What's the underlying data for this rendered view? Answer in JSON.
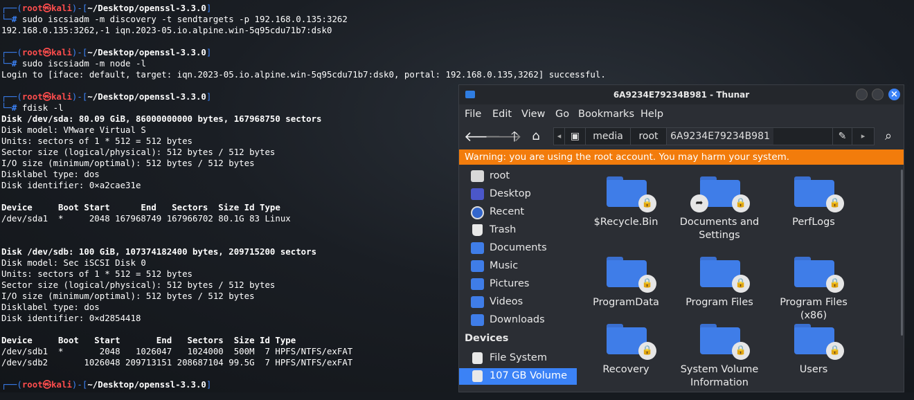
{
  "terminal": {
    "prompt_user": "root",
    "prompt_host": "kali",
    "prompt_path": "~/Desktop/openssl-3.3.0",
    "cmd1": "sudo iscsiadm -m discovery -t sendtargets -p 192.168.0.135:3262",
    "out1": "192.168.0.135:3262,-1 iqn.2023-05.io.alpine.win-5q95cdu71b7:dsk0",
    "cmd2": "sudo iscsiadm -m node -l",
    "out2": "Login to [iface: default, target: iqn.2023-05.io.alpine.win-5q95cdu71b7:dsk0, portal: 192.168.0.135,3262] successful.",
    "cmd3": "fdisk -l",
    "sda": [
      "Disk /dev/sda: 80.09 GiB, 86000000000 bytes, 167968750 sectors",
      "Disk model: VMware Virtual S",
      "Units: sectors of 1 * 512 = 512 bytes",
      "Sector size (logical/physical): 512 bytes / 512 bytes",
      "I/O size (minimum/optimal): 512 bytes / 512 bytes",
      "Disklabel type: dos",
      "Disk identifier: 0×a2cae31e"
    ],
    "sda_table_header": "Device     Boot Start      End   Sectors  Size Id Type",
    "sda_table_row": "/dev/sda1  *     2048 167968749 167966702 80.1G 83 Linux",
    "sdb": [
      "Disk /dev/sdb: 100 GiB, 107374182400 bytes, 209715200 sectors",
      "Disk model: Sec iSCSI Disk 0",
      "Units: sectors of 1 * 512 = 512 bytes",
      "Sector size (logical/physical): 512 bytes / 512 bytes",
      "I/O size (minimum/optimal): 512 bytes / 512 bytes",
      "Disklabel type: dos",
      "Disk identifier: 0×d2854418"
    ],
    "sdb_table_header": "Device     Boot   Start       End   Sectors  Size Id Type",
    "sdb_table_row1": "/dev/sdb1  *       2048   1026047   1024000  500M  7 HPFS/NTFS/exFAT",
    "sdb_table_row2": "/dev/sdb2       1026048 209713151 208687104 99.5G  7 HPFS/NTFS/exFAT"
  },
  "thunar": {
    "title": "6A9234E79234B981 - Thunar",
    "menu": [
      "File",
      "Edit",
      "View",
      "Go",
      "Bookmarks",
      "Help"
    ],
    "path": [
      "media",
      "root",
      "6A9234E79234B981"
    ],
    "warning": "Warning: you are using the root account. You may harm your system.",
    "sidebar": {
      "places": [
        "root",
        "Desktop",
        "Recent",
        "Trash",
        "Documents",
        "Music",
        "Pictures",
        "Videos",
        "Downloads"
      ],
      "devices_header": "Devices",
      "devices": [
        "File System",
        "107 GB Volume"
      ]
    },
    "folders": [
      "$Recycle.Bin",
      "Documents and Settings",
      "PerfLogs",
      "ProgramData",
      "Program Files",
      "Program Files (x86)",
      "Recovery",
      "System Volume Information",
      "Users"
    ]
  }
}
